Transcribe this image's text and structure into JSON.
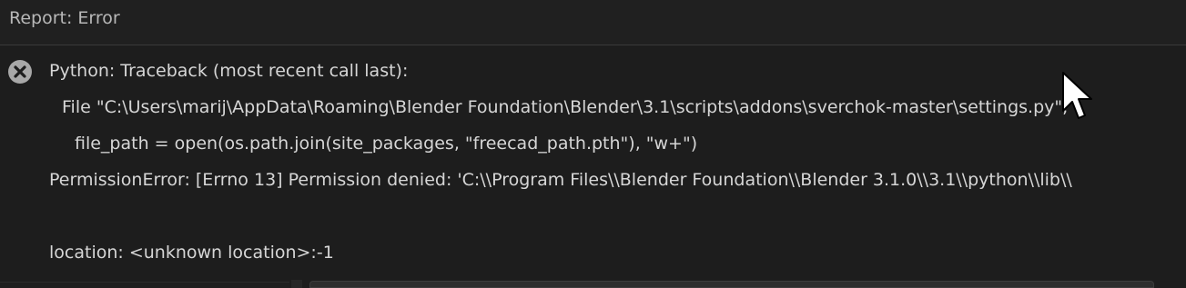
{
  "header": {
    "title": "Report: Error"
  },
  "icons": {
    "error": "error-circle-x-icon",
    "cursor": "mouse-pointer-icon"
  },
  "colors": {
    "background": "#1d1d1d",
    "header_bg": "#202020",
    "text": "#d6d6d6",
    "icon": "#a8a8a8"
  },
  "error": {
    "lines": [
      "Python: Traceback (most recent call last):",
      "File \"C:\\Users\\marij\\AppData\\Roaming\\Blender Foundation\\Blender\\3.1\\scripts\\addons\\sverchok-master\\settings.py\",",
      "file_path = open(os.path.join(site_packages, \"freecad_path.pth\"), \"w+\")",
      "PermissionError: [Errno 13] Permission denied: 'C:\\\\Program Files\\\\Blender Foundation\\\\Blender 3.1.0\\\\3.1\\\\python\\\\lib\\\\",
      "location: <unknown location>:-1"
    ]
  }
}
